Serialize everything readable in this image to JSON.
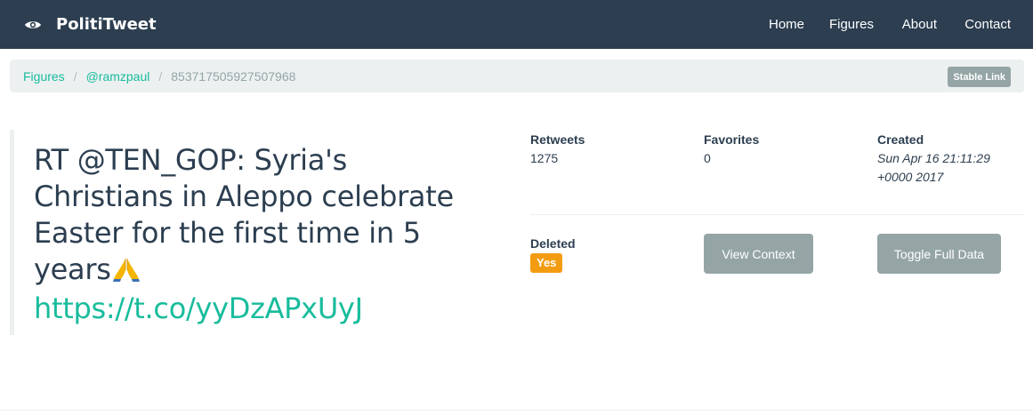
{
  "navbar": {
    "brand": "PolitiTweet",
    "brand_icon": "eye-icon",
    "links": [
      "Home",
      "Figures",
      "About",
      "Contact"
    ]
  },
  "breadcrumb": {
    "items": [
      "Figures",
      "@ramzpaul",
      "853717505927507968"
    ],
    "stable_link": "Stable Link"
  },
  "tweet": {
    "text": "RT @TEN_GOP: Syria's Christians in Aleppo celebrate Easter for the first time in 5 years",
    "emoji_icon": "praying-hands-icon",
    "link": "https://t.co/yyDzAPxUyJ"
  },
  "stats": {
    "retweets_label": "Retweets",
    "retweets_value": "1275",
    "favorites_label": "Favorites",
    "favorites_value": "0",
    "created_label": "Created",
    "created_value": "Sun Apr 16 21:11:29 +0000 2017",
    "deleted_label": "Deleted",
    "deleted_value": "Yes"
  },
  "actions": {
    "view_context": "View Context",
    "toggle_full_data": "Toggle Full Data"
  },
  "colors": {
    "navbar": "#2c3e50",
    "accent": "#18bc9c",
    "muted": "#95a5a6",
    "warning": "#f39c12",
    "breadcrumb_bg": "#ecf0f1"
  }
}
